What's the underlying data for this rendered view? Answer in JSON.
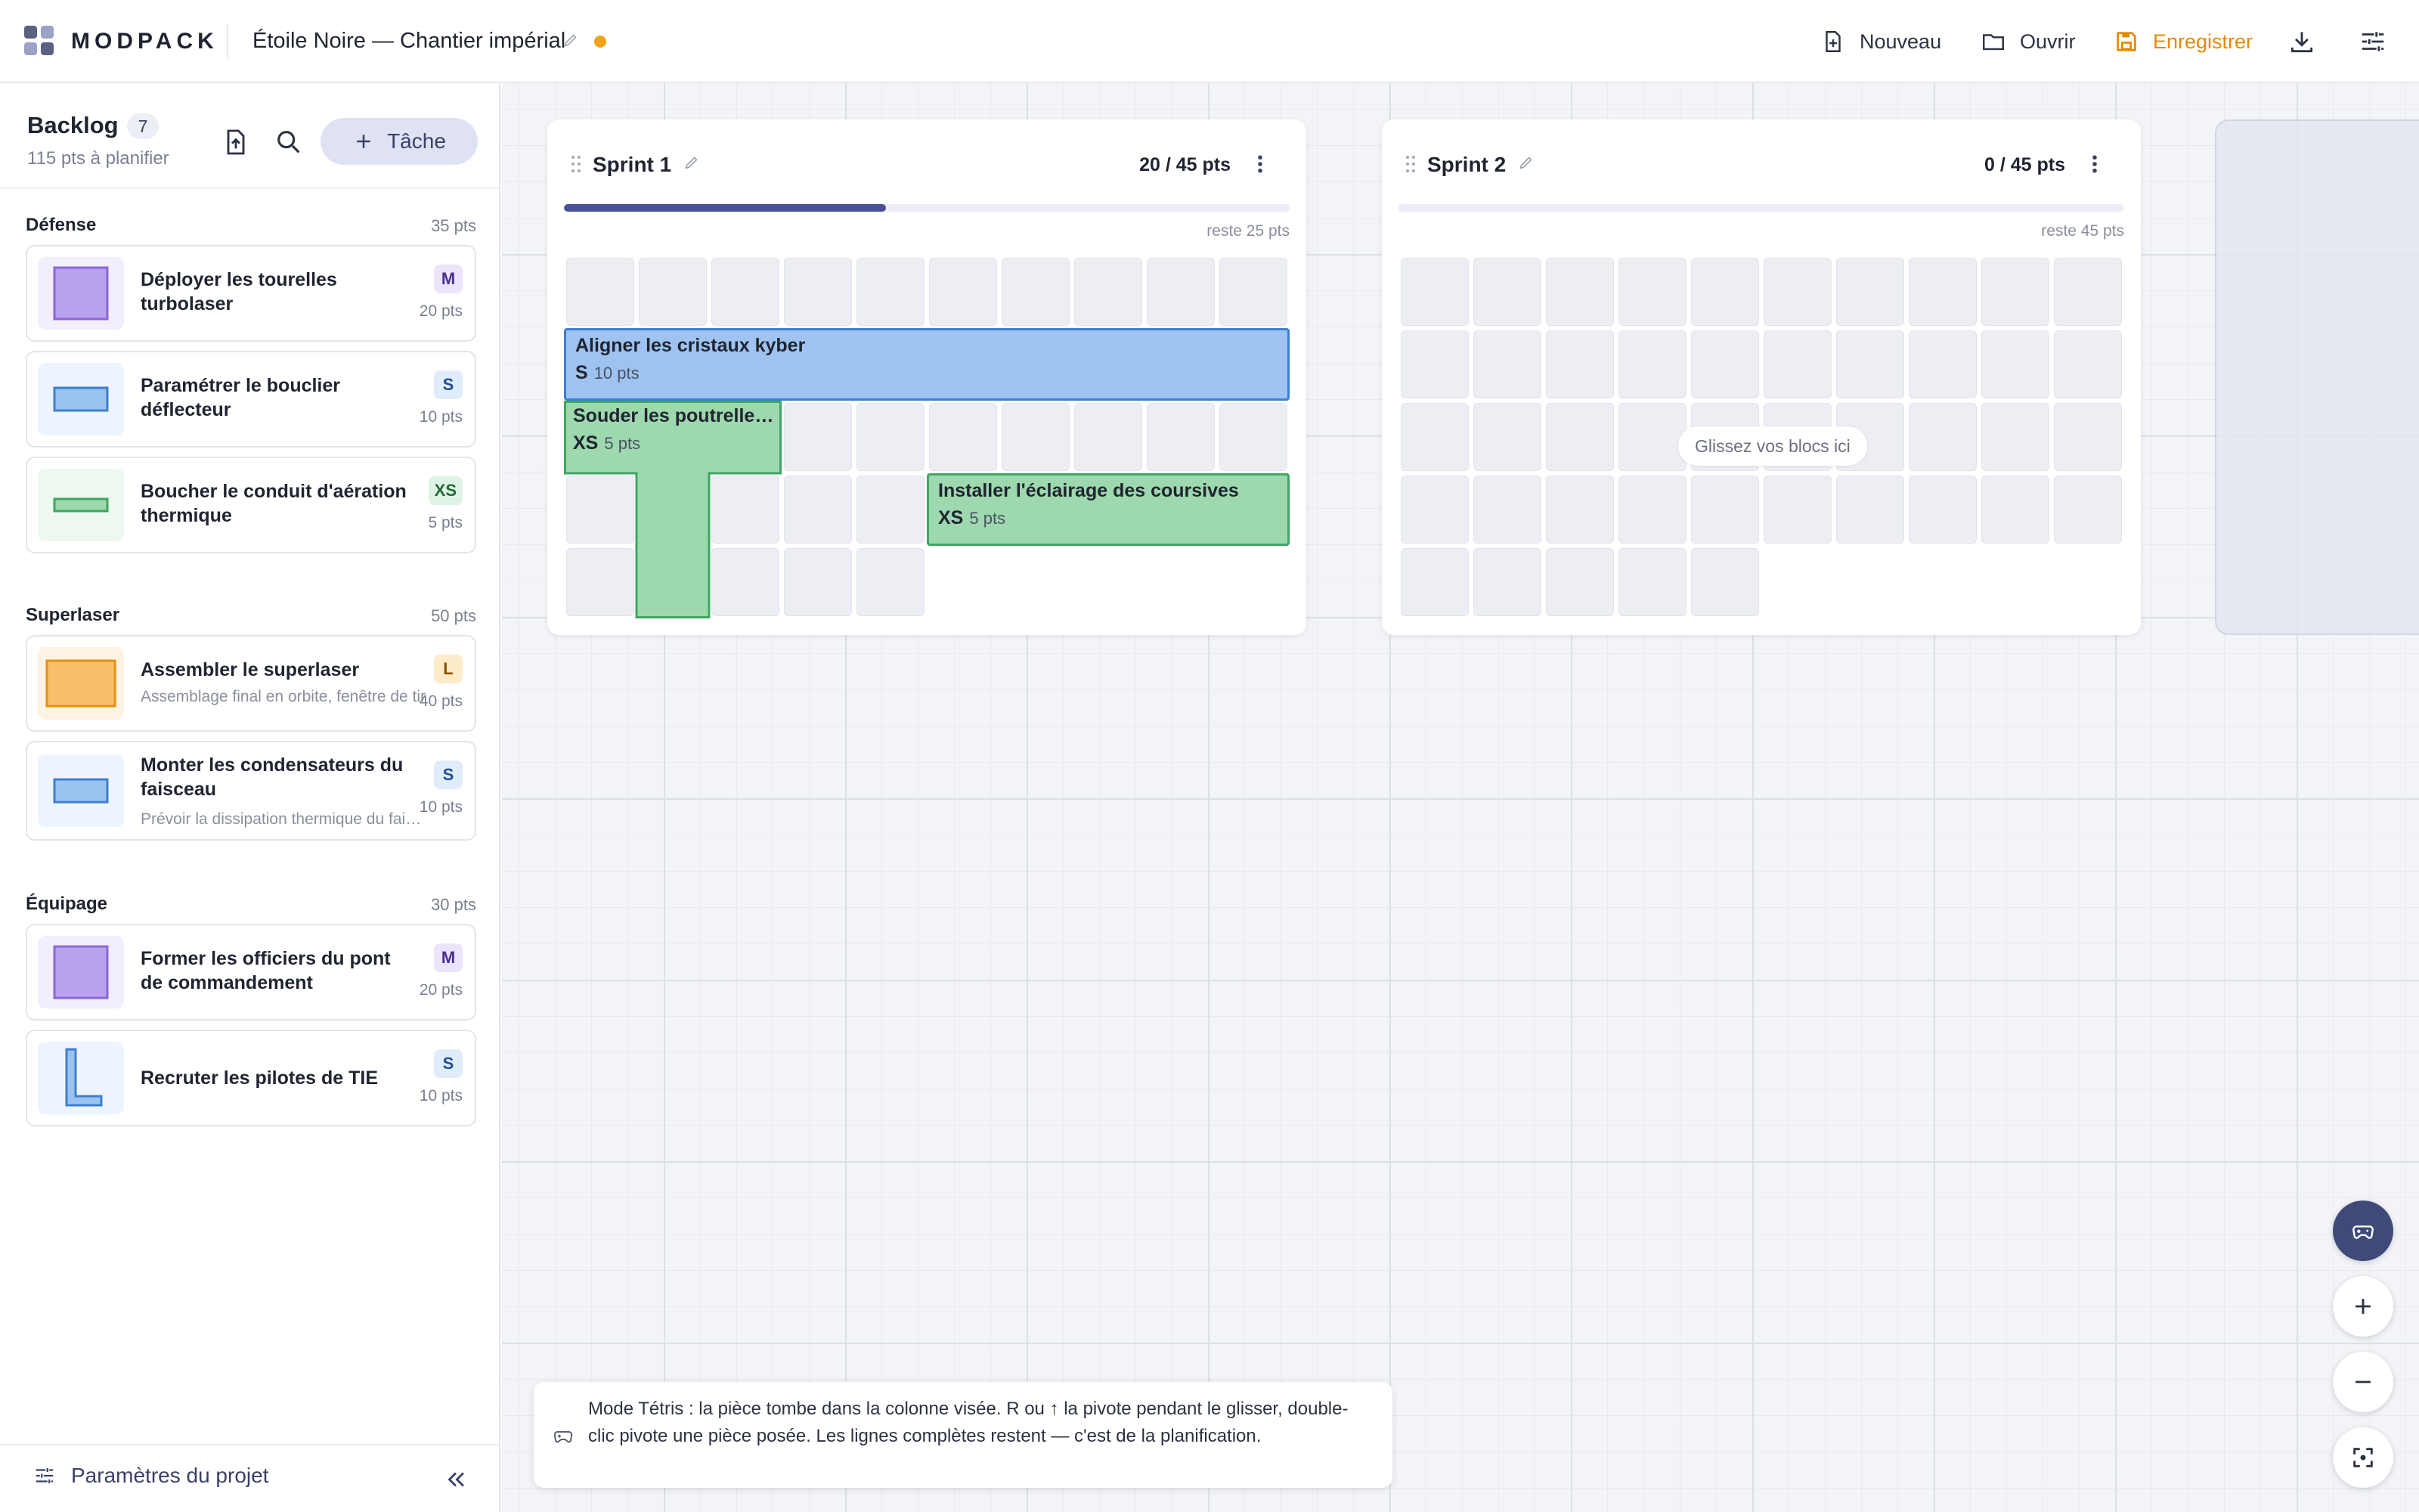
{
  "app": {
    "brand": "MODPACK",
    "project_title": "Étoile Noire — Chantier impérial"
  },
  "toolbar": {
    "new_label": "Nouveau",
    "open_label": "Ouvrir",
    "save_label": "Enregistrer",
    "save_color": "#e38a00",
    "unsaved_dot_color": "#f0a21a"
  },
  "sidebar": {
    "title": "Backlog",
    "count": "7",
    "subtitle": "115 pts à planifier",
    "add_task_label": "Tâche",
    "footer_label": "Paramètres du projet",
    "groups": [
      {
        "name": "Défense",
        "pts": "35 pts",
        "items": [
          {
            "title": "Déployer les tourelles turbolaser",
            "desc": "",
            "size": "M",
            "pts": "20 pts",
            "color": "#b9a2ec"
          },
          {
            "title": "Paramétrer le bouclier déflecteur",
            "desc": "",
            "size": "S",
            "pts": "10 pts",
            "color": "#99c3f1"
          },
          {
            "title": "Boucher le conduit d'aération thermique",
            "desc": "",
            "size": "XS",
            "pts": "5 pts",
            "color": "#9ed8ae"
          }
        ]
      },
      {
        "name": "Superlaser",
        "pts": "50 pts",
        "items": [
          {
            "title": "Assembler le superlaser",
            "desc": "Assemblage final en orbite, fenêtre de tir",
            "size": "L",
            "pts": "40 pts",
            "color": "#f8c06a"
          },
          {
            "title": "Monter les condensateurs du faisceau",
            "desc": "Prévoir la dissipation thermique du faisceau",
            "size": "S",
            "pts": "10 pts",
            "color": "#99c3f1"
          }
        ]
      },
      {
        "name": "Équipage",
        "pts": "30 pts",
        "items": [
          {
            "title": "Former les officiers du pont de commandement",
            "desc": "",
            "size": "M",
            "pts": "20 pts",
            "color": "#b9a2ec"
          },
          {
            "title": "Recruter les pilotes de TIE",
            "desc": "",
            "size": "S",
            "pts": "10 pts",
            "color": "#99c3f1"
          }
        ]
      }
    ]
  },
  "sprints": [
    {
      "name": "Sprint 1",
      "pts": "20 / 45 pts",
      "remaining": "reste 25 pts",
      "progress": 0.444,
      "drop_hint": "",
      "pieces": [
        {
          "title": "Aligner les cristaux kyber",
          "size": "S",
          "pts": "10 pts"
        },
        {
          "title": "Souder les poutrelles de la coque",
          "size": "XS",
          "pts": "5 pts"
        },
        {
          "title": "Installer l'éclairage des coursives",
          "size": "XS",
          "pts": "5 pts"
        }
      ]
    },
    {
      "name": "Sprint 2",
      "pts": "0 / 45 pts",
      "remaining": "reste 45 pts",
      "progress": 0,
      "drop_hint": "Glissez vos blocs ici",
      "pieces": []
    }
  ],
  "tip": {
    "text": "Mode Tétris : la pièce tombe dans la colonne visée. R ou ↑ la pivote pendant le glisser, double-clic pivote une pièce posée. Les lignes complètes restent — c'est de la planification."
  },
  "colors": {
    "accent": "#4b4f95",
    "piece_blue": "#9fc3f0",
    "piece_green": "#9ed8ae"
  }
}
